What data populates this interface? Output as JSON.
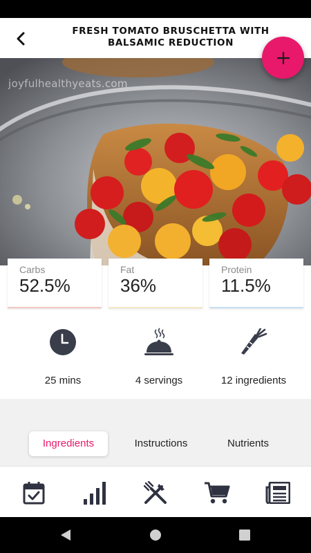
{
  "header": {
    "title": "FRESH TOMATO BRUSCHETTA WITH BALSAMIC REDUCTION",
    "back_icon": "chevron-left-icon",
    "add_icon": "plus-icon"
  },
  "hero": {
    "watermark": "joyfulhealthyeats.com"
  },
  "macros": [
    {
      "label": "Carbs",
      "value": "52.5%"
    },
    {
      "label": "Fat",
      "value": "36%"
    },
    {
      "label": "Protein",
      "value": "11.5%"
    }
  ],
  "info": {
    "time": "25 mins",
    "servings": "4 servings",
    "ingredients": "12 ingredients"
  },
  "tabs": {
    "ingredients": "Ingredients",
    "instructions": "Instructions",
    "nutrients": "Nutrients",
    "active": "Ingredients"
  },
  "bottom_nav": [
    "calendar-check-icon",
    "bar-chart-icon",
    "fork-knife-icon",
    "shopping-cart-icon",
    "newspaper-icon"
  ],
  "colors": {
    "accent": "#e8196a",
    "carbs_underline": "#f3c6bf",
    "fat_underline": "#f7e7c4",
    "protein_underline": "#c6dff3"
  }
}
